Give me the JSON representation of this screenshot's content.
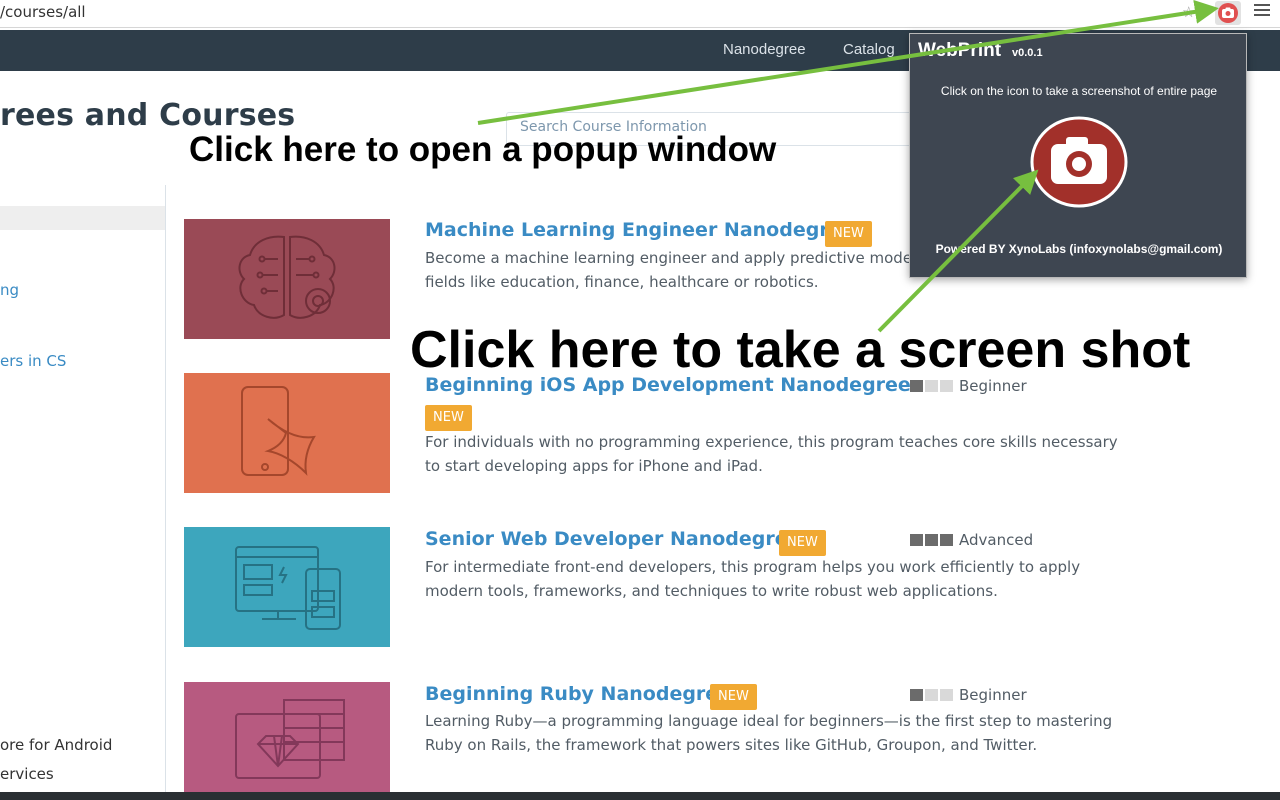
{
  "browser": {
    "url": "/courses/all",
    "colors": {
      "extension_button": "#e05050"
    }
  },
  "site_nav": {
    "links": [
      "Nanodegree",
      "Catalog"
    ],
    "background": "#2e3d49"
  },
  "page": {
    "title": "rees and Courses",
    "search_placeholder": "Search Course Information"
  },
  "sidebar": {
    "items": [
      {
        "label": "ng",
        "style": "link"
      },
      {
        "label": "ers in CS",
        "style": "link"
      },
      {
        "label": "ore for Android",
        "style": "text"
      },
      {
        "label": "ervices",
        "style": "text"
      }
    ]
  },
  "courses": [
    {
      "title": "Machine Learning Engineer Nanodegree",
      "badge": "NEW",
      "description_lines": [
        "Become a machine learning engineer and apply predictive model",
        "fields like education, finance, healthcare or robotics."
      ],
      "level": "",
      "level_bars": 0,
      "thumb_color": "#9a4a56",
      "thumb_icon": "brain-icon"
    },
    {
      "title": "Beginning iOS App Development Nanodegree",
      "badge": "NEW",
      "description_lines": [
        "For individuals with no programming experience, this program teaches core skills necessary",
        "to start developing apps for iPhone and iPad."
      ],
      "level": "Beginner",
      "level_bars": 1,
      "thumb_color": "#e0714f",
      "thumb_icon": "swift-phone-icon"
    },
    {
      "title": "Senior Web Developer Nanodegree",
      "badge": "NEW",
      "description_lines": [
        "For intermediate front-end developers, this program helps you work efficiently to apply",
        "modern tools, frameworks, and techniques to write robust web applications."
      ],
      "level": "Advanced",
      "level_bars": 3,
      "thumb_color": "#3da6bd",
      "thumb_icon": "devices-icon"
    },
    {
      "title": "Beginning Ruby Nanodegree",
      "badge": "NEW",
      "description_lines": [
        "Learning Ruby—a programming language ideal for beginners—is the first step to mastering",
        "Ruby on Rails, the framework that powers sites like GitHub, Groupon, and Twitter."
      ],
      "level": "Beginner",
      "level_bars": 1,
      "thumb_color": "#b75a80",
      "thumb_icon": "ruby-monitor-icon"
    }
  ],
  "popup": {
    "title": "WebPrint",
    "version": "v0.0.1",
    "instruction": "Click on the icon to take a screenshot of entire page",
    "footer": "Powered BY XynoLabs (infoxynolabs@gmail.com)",
    "camera_icon": "camera-icon"
  },
  "annotations": {
    "popup_hint": "Click here to open a popup window",
    "screenshot_hint": "Click here to take a screen shot",
    "arrow_color": "#77bf3f"
  }
}
